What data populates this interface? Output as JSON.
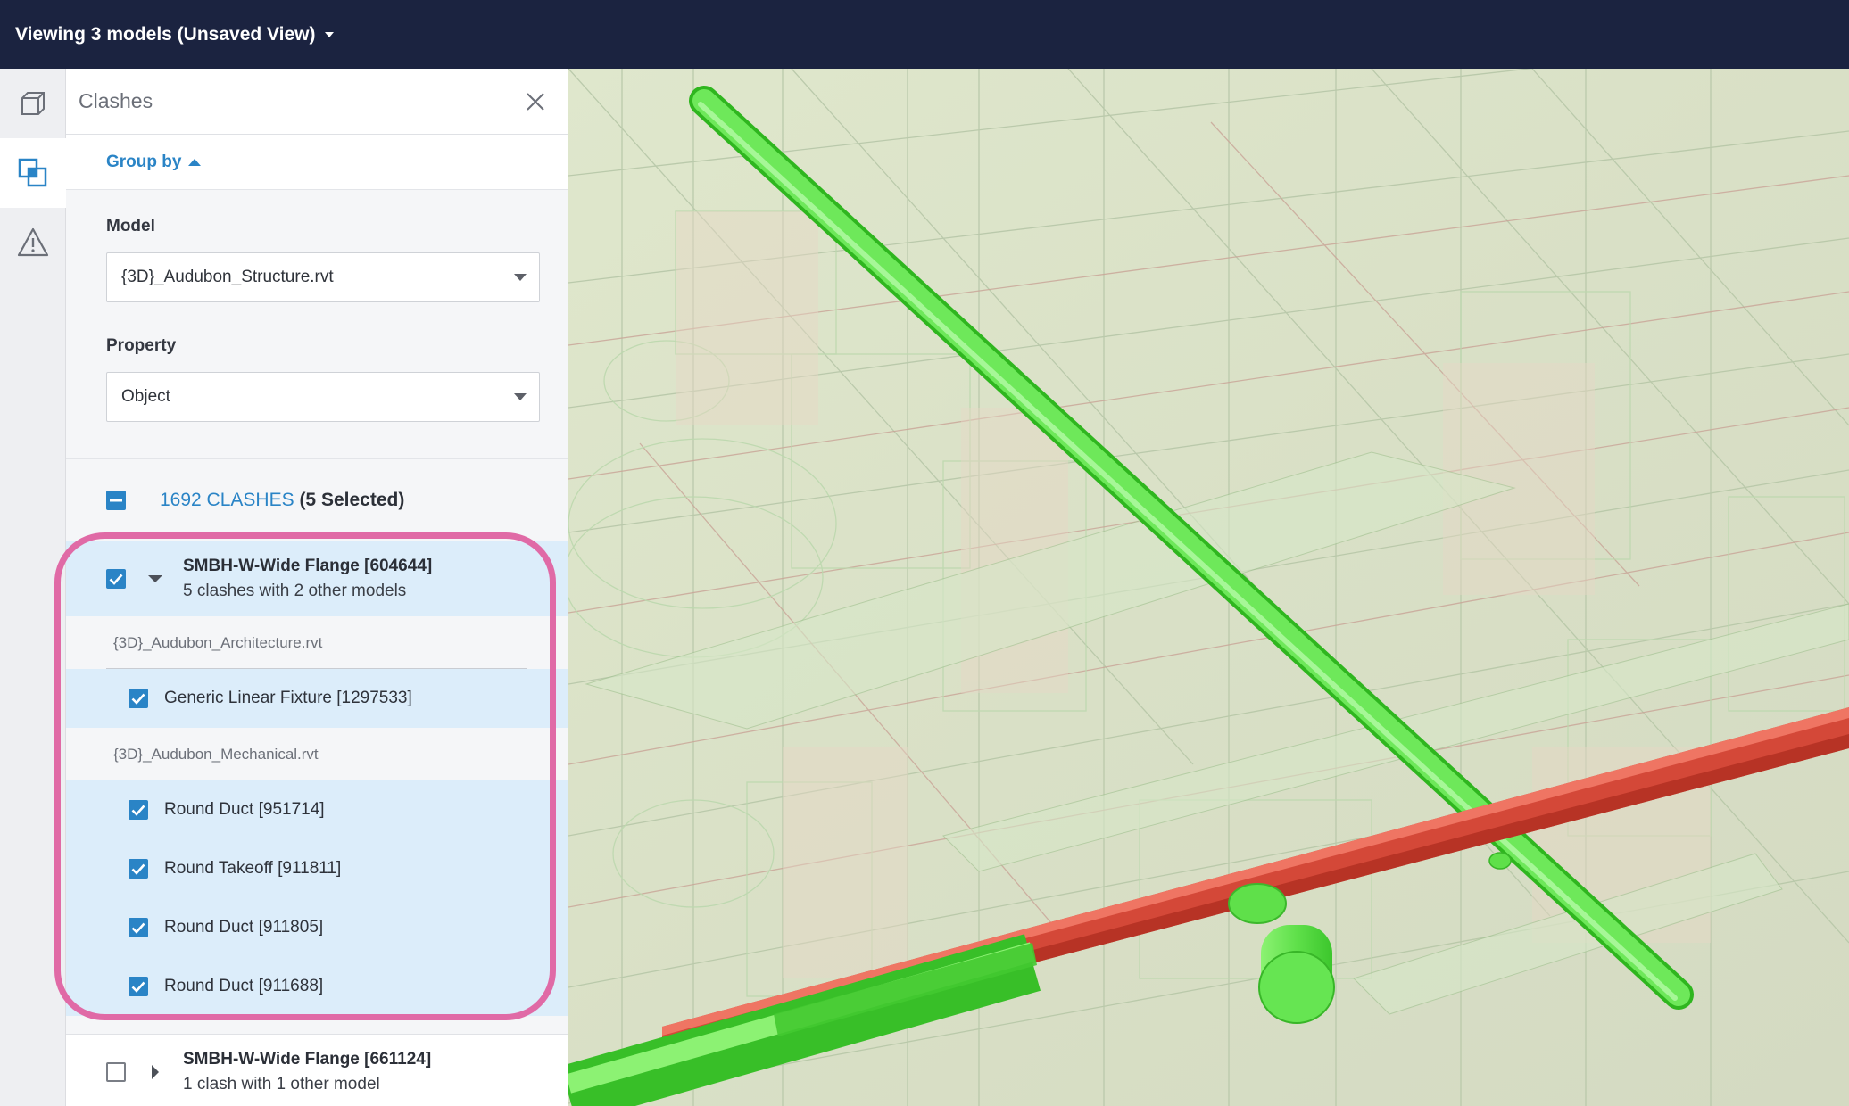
{
  "topbar": {
    "view_title": "Viewing 3 models (Unsaved View)"
  },
  "rail": {
    "items": [
      "cube-icon",
      "clash-icon",
      "warning-icon"
    ],
    "active": "clash-icon"
  },
  "panel": {
    "title": "Clashes",
    "group_by_label": "Group by",
    "model_label": "Model",
    "model_value": "{3D}_Audubon_Structure.rvt",
    "property_label": "Property",
    "property_value": "Object",
    "summary": {
      "count_text": "1692 CLASHES",
      "selected_text": "(5 Selected)"
    },
    "groups": [
      {
        "title": "SMBH-W-Wide Flange [604644]",
        "subtitle": "5 clashes with 2 other models",
        "checked": true,
        "expanded": true,
        "models": [
          {
            "name": "{3D}_Audubon_Architecture.rvt",
            "objects": [
              "Generic Linear Fixture [1297533]"
            ]
          },
          {
            "name": "{3D}_Audubon_Mechanical.rvt",
            "objects": [
              "Round Duct [951714]",
              "Round Takeoff [911811]",
              "Round Duct [911805]",
              "Round Duct [911688]"
            ]
          }
        ]
      },
      {
        "title": "SMBH-W-Wide Flange [661124]",
        "subtitle": "1 clash with 1 other model",
        "checked": false,
        "expanded": false
      }
    ]
  },
  "colors": {
    "topbar": "#1b2340",
    "accent": "#2a84c6",
    "selected_row": "#dcedfa",
    "highlight_frame": "#e06aa6",
    "clash_green": "#5fe04a",
    "clash_red": "#dc4a3a"
  }
}
